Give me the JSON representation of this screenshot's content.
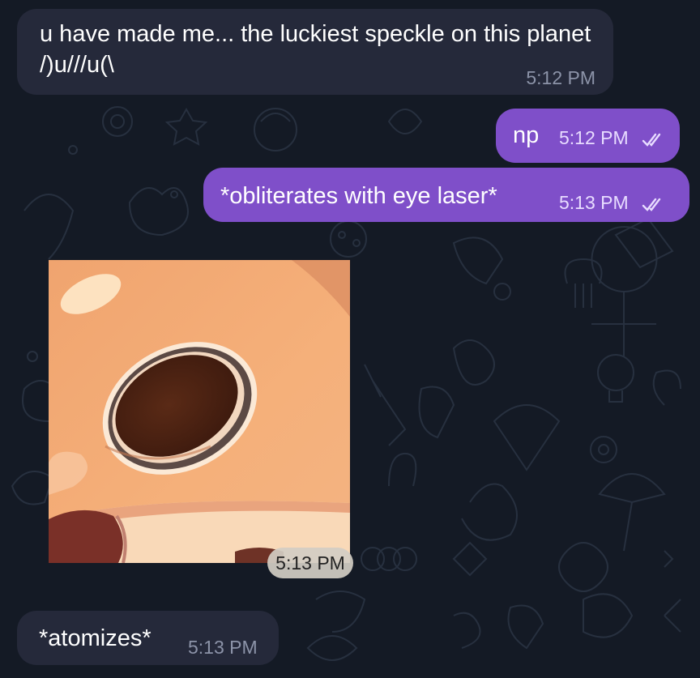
{
  "messages": [
    {
      "direction": "in",
      "text": "u have made me... the luckiest speckle on this planet /)u///u(\\",
      "time": "5:12 PM"
    },
    {
      "direction": "out",
      "text": "np",
      "time": "5:12 PM",
      "read": true
    },
    {
      "direction": "out",
      "text": "*obliterates with eye laser*",
      "time": "5:13 PM",
      "read": true
    },
    {
      "direction": "in",
      "type": "photo",
      "time": "5:13 PM"
    },
    {
      "direction": "in",
      "text": "*atomizes*",
      "time": "5:13 PM"
    }
  ],
  "colors": {
    "background": "#141a25",
    "incoming_bubble": "#25293a",
    "outgoing_bubble": "#7f4fc9"
  },
  "icons": [
    "double-check-icon"
  ]
}
